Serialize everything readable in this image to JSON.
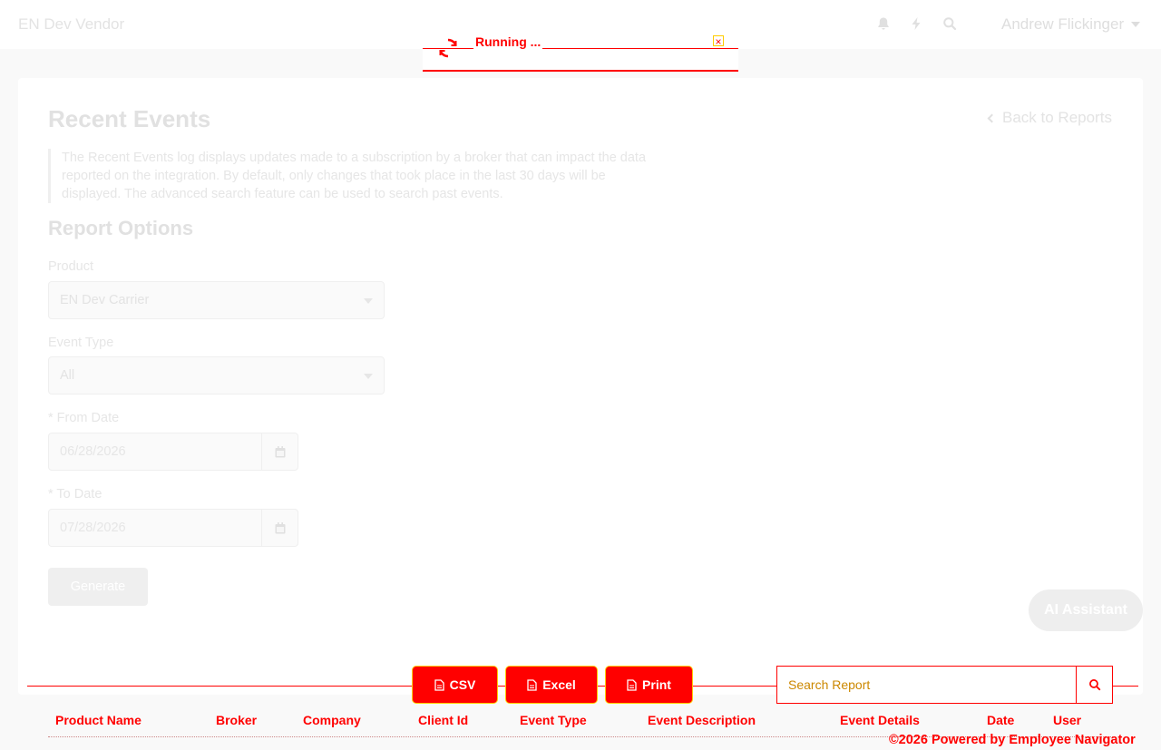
{
  "header": {
    "brand": "EN Dev Vendor",
    "user_name": "Andrew Flickinger",
    "icons": [
      "bell-icon",
      "bolt-icon",
      "search-icon"
    ]
  },
  "toast": {
    "text": "Running ...",
    "color": "#ff0000"
  },
  "page": {
    "title": "Recent Events",
    "back_label": "Back to Reports",
    "description": "The Recent Events log displays updates made to a subscription by a broker that can impact the data reported on the integration. By default, only changes that took place in the last 30 days will be displayed. The advanced search feature can be used to search past events.",
    "section_title": "Report Options"
  },
  "form": {
    "product": {
      "label": "Product",
      "value": "EN Dev Carrier"
    },
    "event_type": {
      "label": "Event Type",
      "value": "All"
    },
    "from_date": {
      "label": "* From Date",
      "value": "06/28/2026"
    },
    "to_date": {
      "label": "* To Date",
      "value": "07/28/2026"
    },
    "generate_label": "Generate"
  },
  "ai_assistant": {
    "label": "AI Assistant"
  },
  "toolbar": {
    "csv_label": "CSV",
    "excel_label": "Excel",
    "print_label": "Print",
    "search_placeholder": "Search Report"
  },
  "table": {
    "columns": [
      "Product Name",
      "Broker",
      "Company",
      "Client Id",
      "Event Type",
      "Event Description",
      "Event Details",
      "Date",
      "User"
    ]
  },
  "footer": {
    "text": "©2026 Powered by Employee Navigator"
  }
}
